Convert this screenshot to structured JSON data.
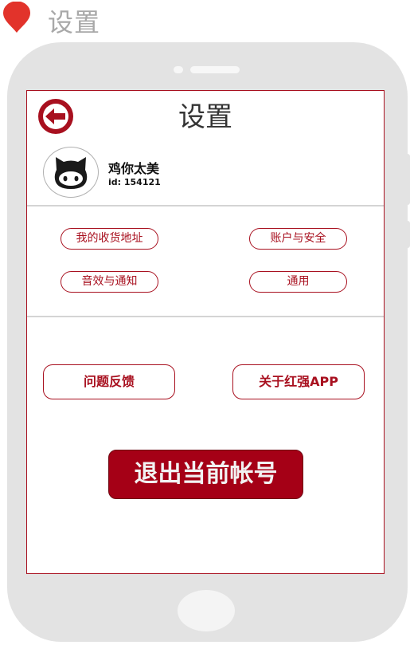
{
  "header": {
    "page_label": "设置"
  },
  "screen": {
    "title": "设置",
    "icons": {
      "back": "back-arrow-circle-icon",
      "avatar": "github-octocat-icon",
      "pin": "map-pin-icon"
    },
    "user": {
      "name": "鸡你太美",
      "id": "id:  154121"
    },
    "options": [
      {
        "label": "我的收货地址"
      },
      {
        "label": "账户与安全"
      },
      {
        "label": "音效与通知"
      },
      {
        "label": "通用"
      }
    ],
    "feedback_label": "问题反馈",
    "about_label": "关于红强APP",
    "logout_label": "退出当前帐号"
  },
  "colors": {
    "accent": "#a8101f",
    "logout_bg": "#a50016",
    "phone_frame": "#e3e3e3"
  }
}
